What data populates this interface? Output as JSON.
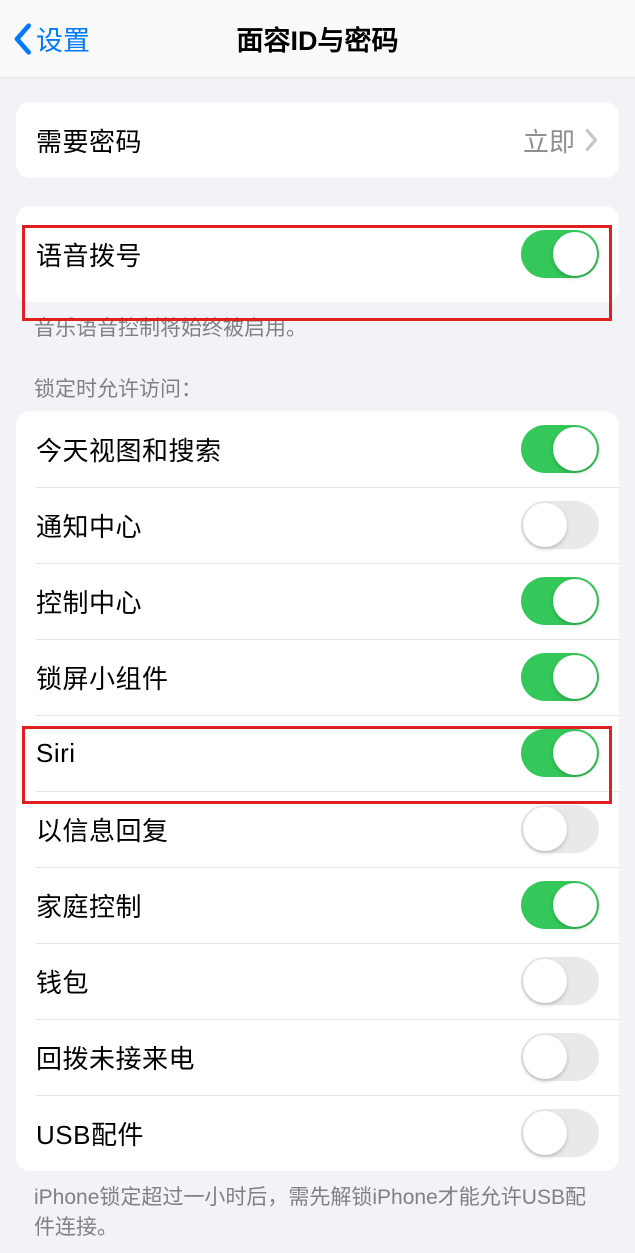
{
  "nav": {
    "back_label": "设置",
    "title": "面容ID与密码"
  },
  "require_passcode": {
    "label": "需要密码",
    "value": "立即"
  },
  "voice_dial": {
    "label": "语音拨号",
    "on": true,
    "footer": "音乐语音控制将始终被启用。"
  },
  "locked_access": {
    "header": "锁定时允许访问：",
    "items": [
      {
        "label": "今天视图和搜索",
        "on": true
      },
      {
        "label": "通知中心",
        "on": false
      },
      {
        "label": "控制中心",
        "on": true
      },
      {
        "label": "锁屏小组件",
        "on": true
      },
      {
        "label": "Siri",
        "on": true
      },
      {
        "label": "以信息回复",
        "on": false
      },
      {
        "label": "家庭控制",
        "on": true
      },
      {
        "label": "钱包",
        "on": false
      },
      {
        "label": "回拨未接来电",
        "on": false
      },
      {
        "label": "USB配件",
        "on": false
      }
    ],
    "footer": "iPhone锁定超过一小时后，需先解锁iPhone才能允许USB配件连接。"
  }
}
